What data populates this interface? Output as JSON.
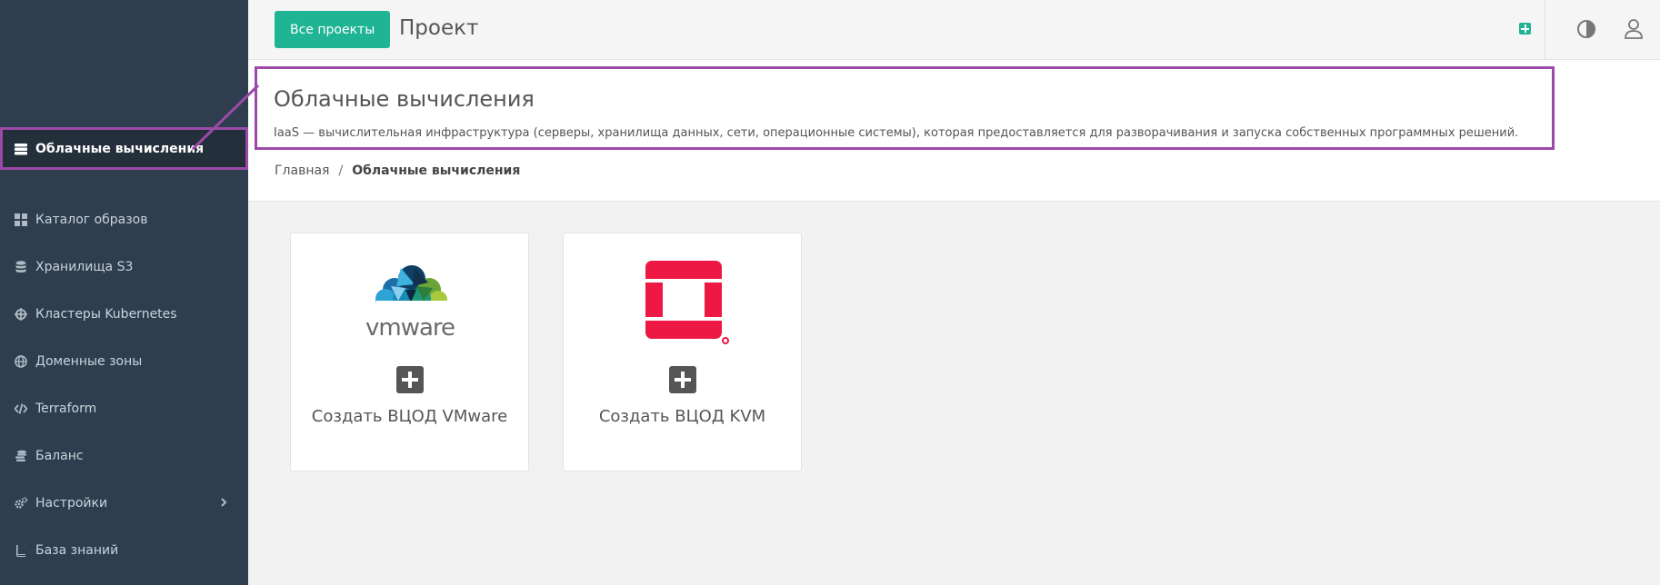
{
  "sidebar": {
    "items": [
      {
        "label": "Облачные вычисления",
        "icon": "server-icon",
        "active": true
      },
      {
        "label": "Каталог образов",
        "icon": "grid-icon"
      },
      {
        "label": "Хранилища S3",
        "icon": "database-icon"
      },
      {
        "label": "Кластеры Kubernetes",
        "icon": "helm-icon"
      },
      {
        "label": "Доменные зоны",
        "icon": "globe-icon"
      },
      {
        "label": "Terraform",
        "icon": "code-icon"
      },
      {
        "label": "Баланс",
        "icon": "coins-icon"
      },
      {
        "label": "Настройки",
        "icon": "gears-icon",
        "has_submenu": true
      },
      {
        "label": "База знаний",
        "icon": "book-icon"
      }
    ]
  },
  "topbar": {
    "all_projects_label": "Все проекты",
    "project_title": "Проект",
    "add_icon": "plus-square-icon",
    "theme_icon": "contrast-icon",
    "user_icon": "user-icon"
  },
  "header": {
    "title": "Облачные вычисления",
    "description": "IaaS — вычислительная инфраструктура (серверы, хранилища данных, сети, операционные системы), которая предоставляется для разворачивания и запуска собственных программных решений."
  },
  "breadcrumb": {
    "home": "Главная",
    "separator": "/",
    "current": "Облачные вычисления"
  },
  "cards": [
    {
      "label": "Создать ВЦОД VMware",
      "logo": "vmware-logo",
      "logo_text": "vmware"
    },
    {
      "label": "Создать ВЦОД KVM",
      "logo": "openstack-logo"
    }
  ],
  "colors": {
    "sidebar_bg": "#2f3e4e",
    "accent": "#1fb494",
    "highlight": "#9b4aa8",
    "openstack_red": "#ed1944"
  }
}
